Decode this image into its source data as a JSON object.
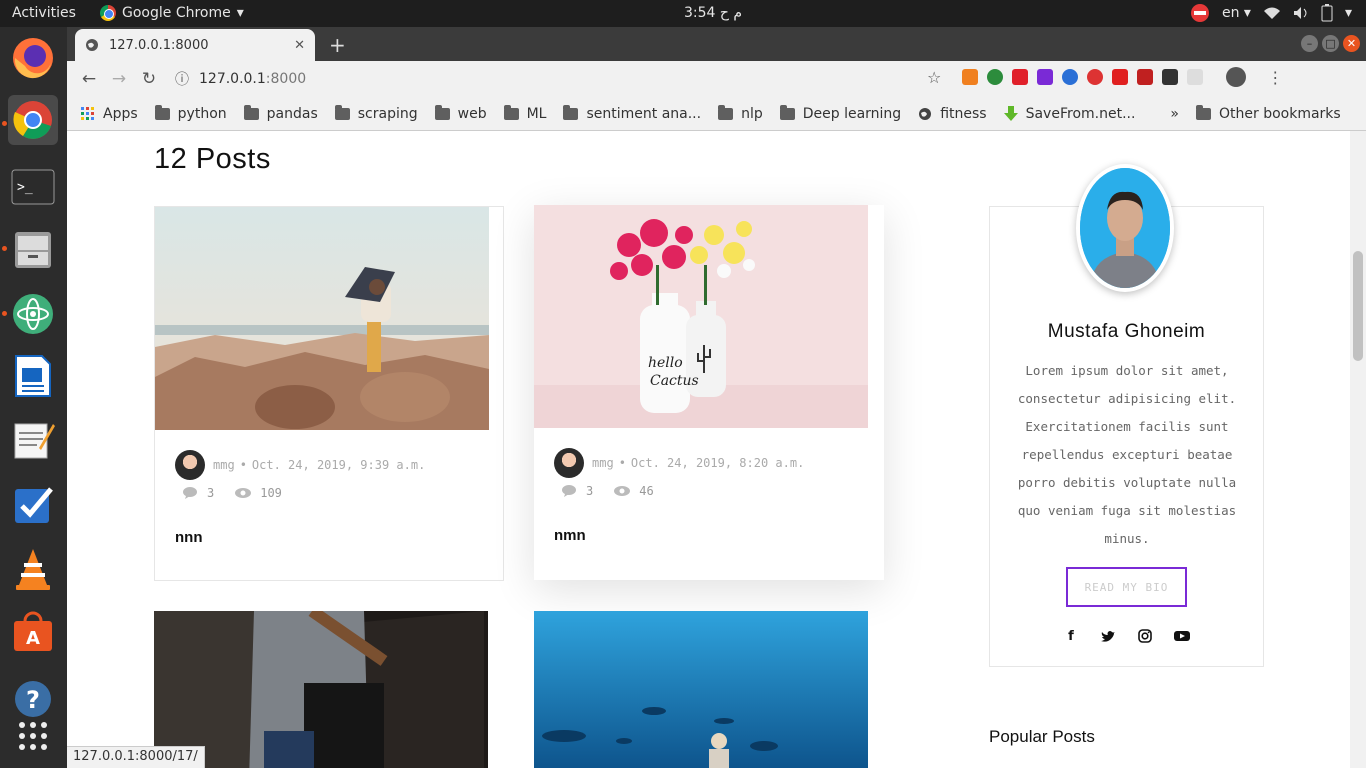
{
  "topbar": {
    "activities": "Activities",
    "app_name": "Google Chrome",
    "clock": "3:54 م ح",
    "language": "en"
  },
  "browser": {
    "tab_title": "127.0.0.1:8000",
    "url_host": "127.0.0.1",
    "url_port": ":8000",
    "bookmarks": [
      "Apps",
      "python",
      "pandas",
      "scraping",
      "web",
      "ML",
      "sentiment ana...",
      "nlp",
      "Deep learning",
      "fitness",
      "SaveFrom.net...",
      "»",
      "Other bookmarks"
    ],
    "status_url": "127.0.0.1:8000/17/"
  },
  "page": {
    "heading": "12 Posts",
    "posts": [
      {
        "author": "mmg",
        "date": "Oct. 24, 2019, 9:39 a.m.",
        "comments": "3",
        "views": "109",
        "title": "nnn"
      },
      {
        "author": "mmg",
        "date": "Oct. 24, 2019, 8:20 a.m.",
        "comments": "3",
        "views": "46",
        "title": "nmn"
      }
    ],
    "bio": {
      "name": "Mustafa Ghoneim",
      "text": "Lorem ipsum dolor sit amet, consectetur adipisicing elit. Exercitationem facilis sunt repellendus excepturi beatae porro debitis voluptate nulla quo veniam fuga sit molestias minus.",
      "button": "READ MY BIO",
      "accent": "#7a2ad6"
    },
    "popular_heading": "Popular Posts"
  },
  "icons": [
    "firefox-icon",
    "chrome-icon",
    "terminal-icon",
    "files-icon",
    "atom-icon",
    "writer-icon",
    "text-editor-icon",
    "tasks-icon",
    "vlc-icon",
    "software-icon",
    "help-icon",
    "apps-grid-icon"
  ]
}
